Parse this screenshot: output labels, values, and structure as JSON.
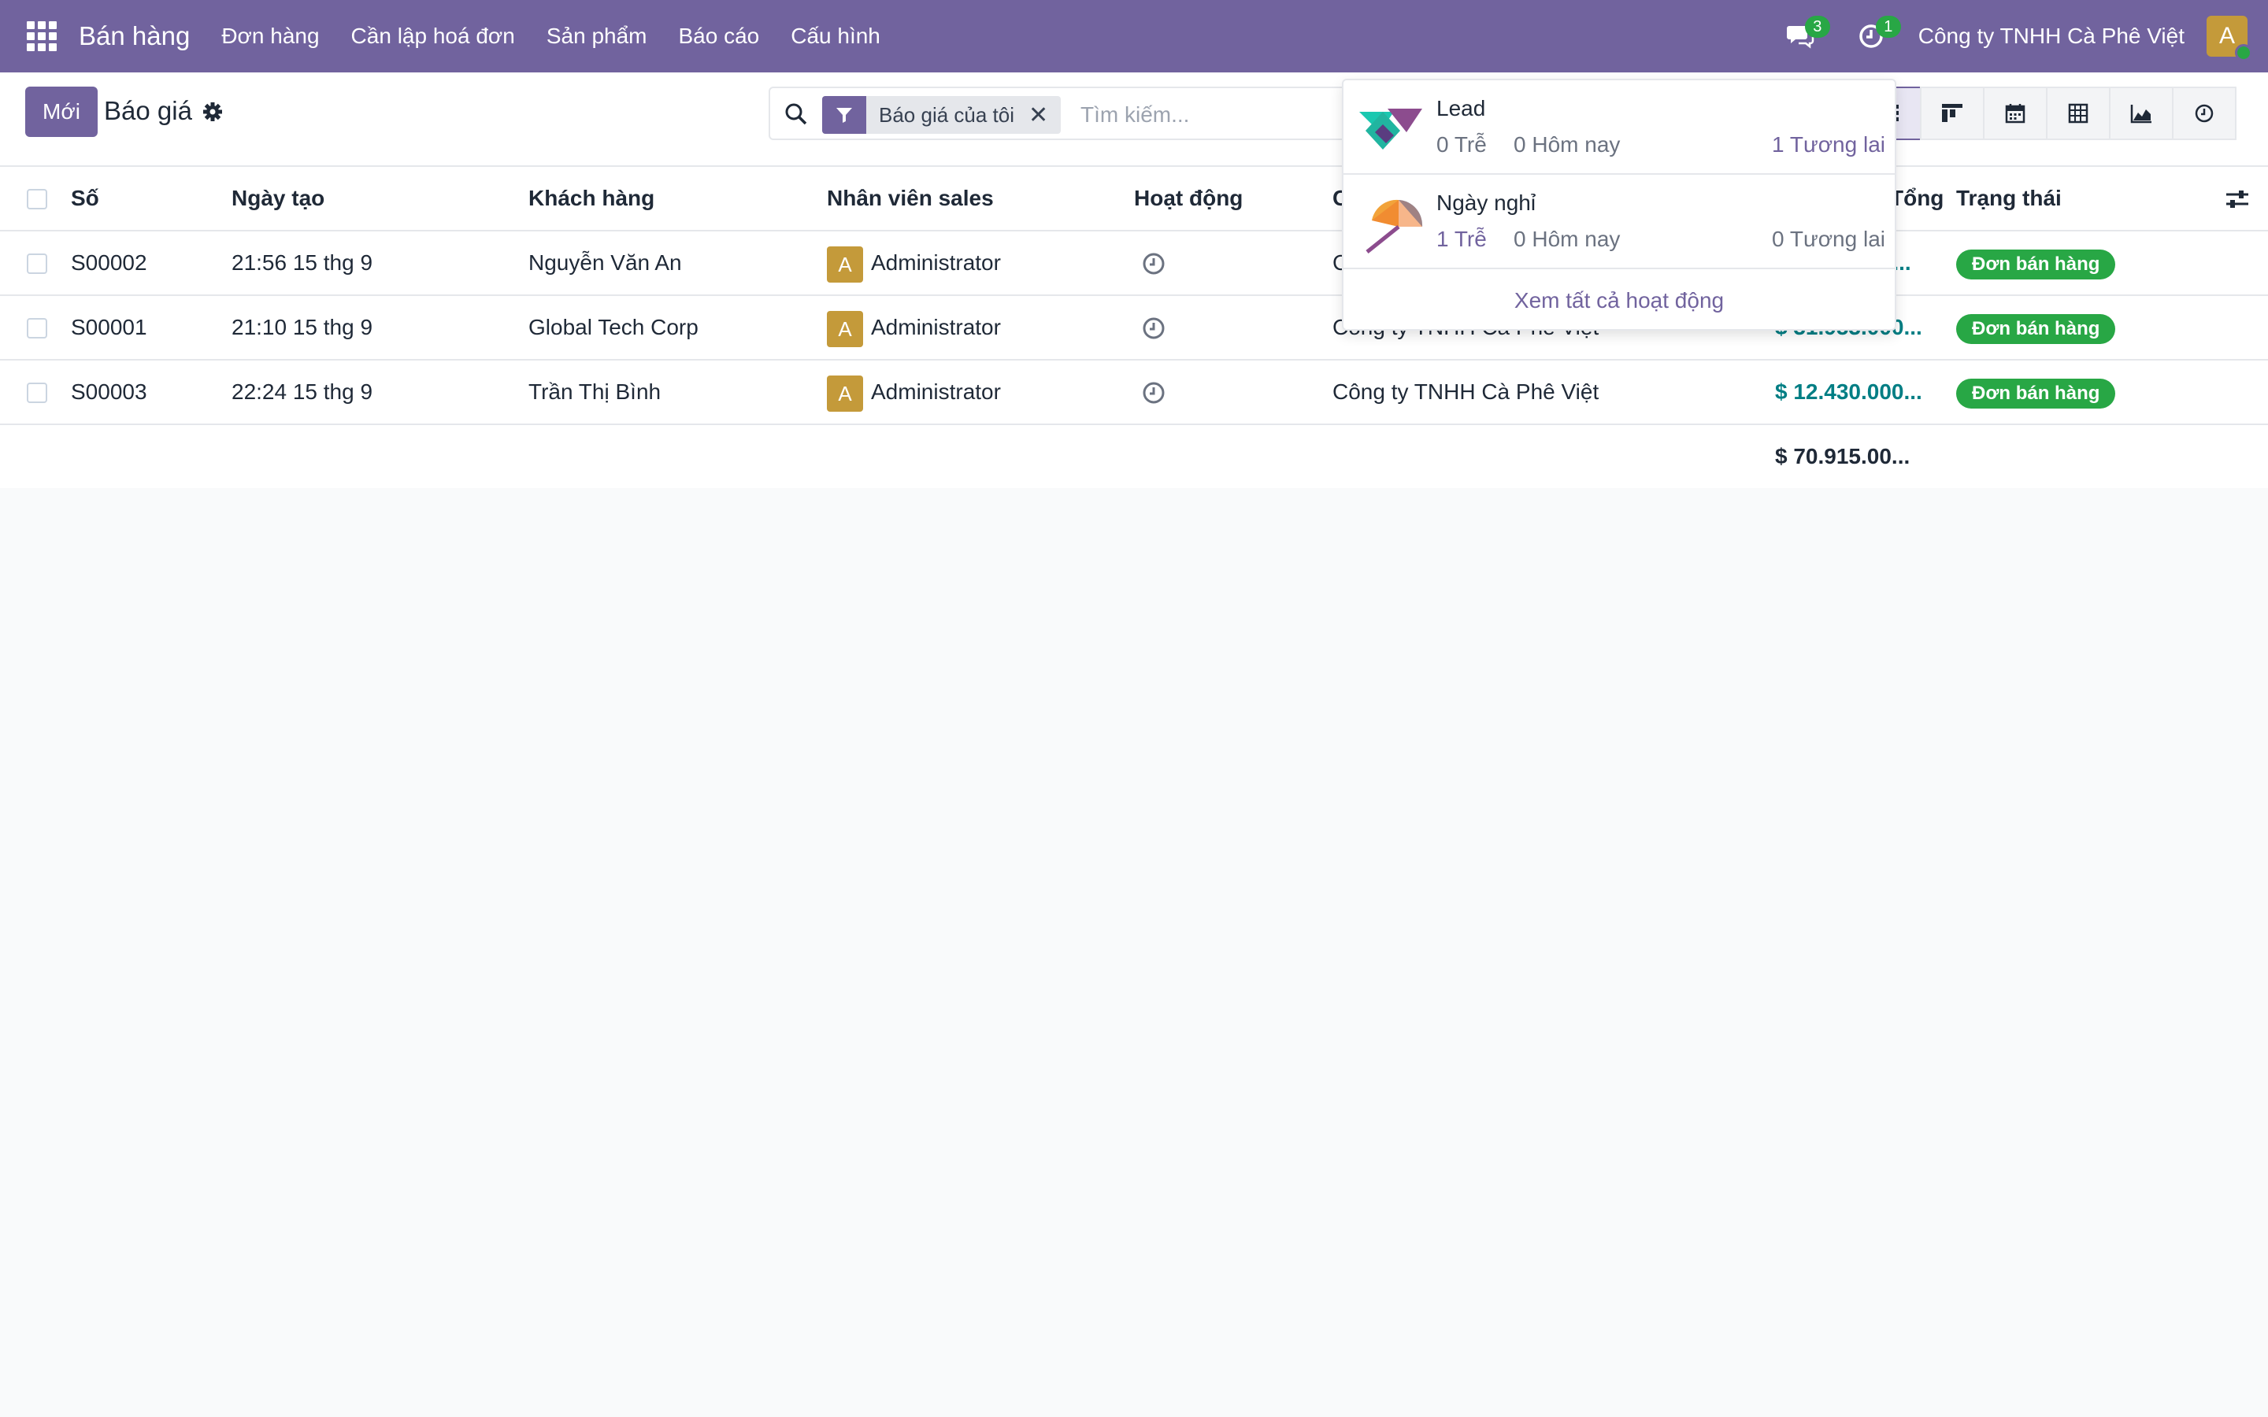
{
  "navbar": {
    "app_name": "Bán hàng",
    "menu": [
      "Đơn hàng",
      "Cần lập hoá đơn",
      "Sản phẩm",
      "Báo cáo",
      "Cấu hình"
    ],
    "messages_count": "3",
    "activities_count": "1",
    "company": "Công ty TNHH Cà Phê Việt",
    "user_initial": "A"
  },
  "control": {
    "new_label": "Mới",
    "title": "Báo giá",
    "facet_label": "Báo giá của tôi",
    "facet_close": "✕",
    "search_placeholder": "Tìm kiếm..."
  },
  "table": {
    "columns": [
      "Số",
      "Ngày tạo",
      "Khách hàng",
      "Nhân viên sales",
      "Hoạt động",
      "C",
      "Tổng",
      "Trạng thái"
    ],
    "rows": [
      {
        "number": "S00002",
        "date": "21:56 15 thg 9",
        "customer": "Nguyễn Văn An",
        "initial": "A",
        "salesperson": "Administrator",
        "company": "Cô",
        "total": "0,...",
        "status": "Đơn bán hàng"
      },
      {
        "number": "S00001",
        "date": "21:10 15 thg 9",
        "customer": "Global Tech Corp",
        "initial": "A",
        "salesperson": "Administrator",
        "company": "Công ty TNHH Cà Phê Việt",
        "total": "$ 31.953.000...",
        "status": "Đơn bán hàng"
      },
      {
        "number": "S00003",
        "date": "22:24 15 thg 9",
        "customer": "Trần Thị Bình",
        "initial": "A",
        "salesperson": "Administrator",
        "company": "Công ty TNHH Cà Phê Việt",
        "total": "$ 12.430.000...",
        "status": "Đơn bán hàng"
      }
    ],
    "grand_total": "$ 70.915.00..."
  },
  "activity_popover": {
    "items": [
      {
        "name": "Lead",
        "late": "0 Trễ",
        "today": "0 Hôm nay",
        "future": "1 Tương lai"
      },
      {
        "name": "Ngày nghỉ",
        "late": "1 Trễ",
        "today": "0 Hôm nay",
        "future": "0 Tương lai"
      }
    ],
    "view_all": "Xem tất cả hoạt động"
  },
  "colors": {
    "brand": "#71639e",
    "success": "#28a745",
    "amount": "#017e84"
  }
}
